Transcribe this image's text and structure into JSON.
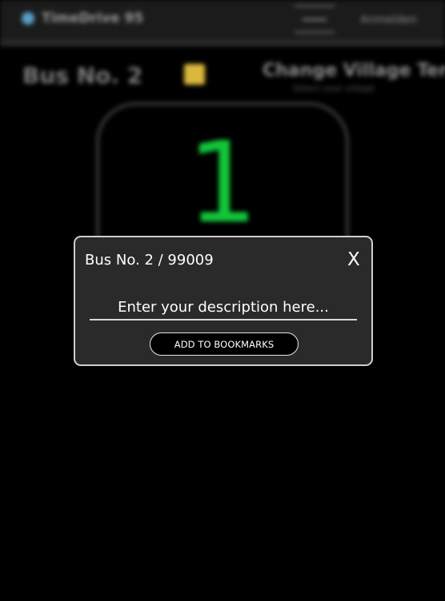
{
  "header": {
    "app_title": "TimeDrive 95",
    "login_label": "Anmelden",
    "logo_icon": "app-logo-icon",
    "menu_icon": "menu-icon"
  },
  "background": {
    "bus_heading": "Bus No. 2",
    "favorite_icon": "star-icon",
    "change_title": "Change Village Ter",
    "change_subtitle": "Select your village",
    "counter_value": "1",
    "counter_color": "#12c63a"
  },
  "modal": {
    "title": "Bus No. 2 / 99009",
    "close_label": "X",
    "description_placeholder": "Enter your description here...",
    "description_value": "",
    "add_button_label": "ADD TO BOOKMARKS"
  },
  "colors": {
    "page_background": "#000000",
    "modal_background": "#2a2a2a",
    "modal_border": "#cfcfcf"
  }
}
